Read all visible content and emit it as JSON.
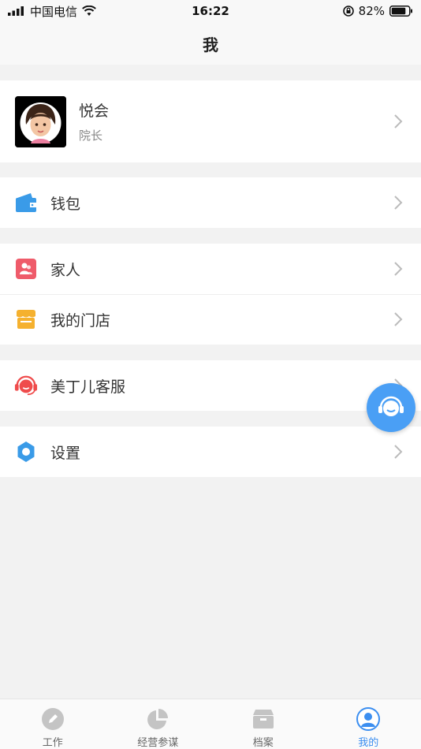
{
  "status_bar": {
    "carrier": "中国电信",
    "time": "16:22",
    "battery": "82%"
  },
  "nav": {
    "title": "我"
  },
  "profile": {
    "name": "悦会",
    "role": "院长"
  },
  "menu": {
    "wallet": "钱包",
    "family": "家人",
    "my_store": "我的门店",
    "customer_service": "美丁儿客服",
    "settings": "设置"
  },
  "tabs": [
    {
      "label": "工作",
      "icon": "pencil-icon"
    },
    {
      "label": "经营参谋",
      "icon": "pie-chart-icon"
    },
    {
      "label": "档案",
      "icon": "archive-box-icon"
    },
    {
      "label": "我的",
      "icon": "user-icon",
      "active": true
    }
  ],
  "colors": {
    "accent": "#3b8ef0",
    "fab": "#4a9ff5",
    "wallet": "#3a9be8",
    "family": "#ef5b6a",
    "store": "#f5b12f",
    "service": "#ef4c4c",
    "settings": "#3a9be8"
  }
}
